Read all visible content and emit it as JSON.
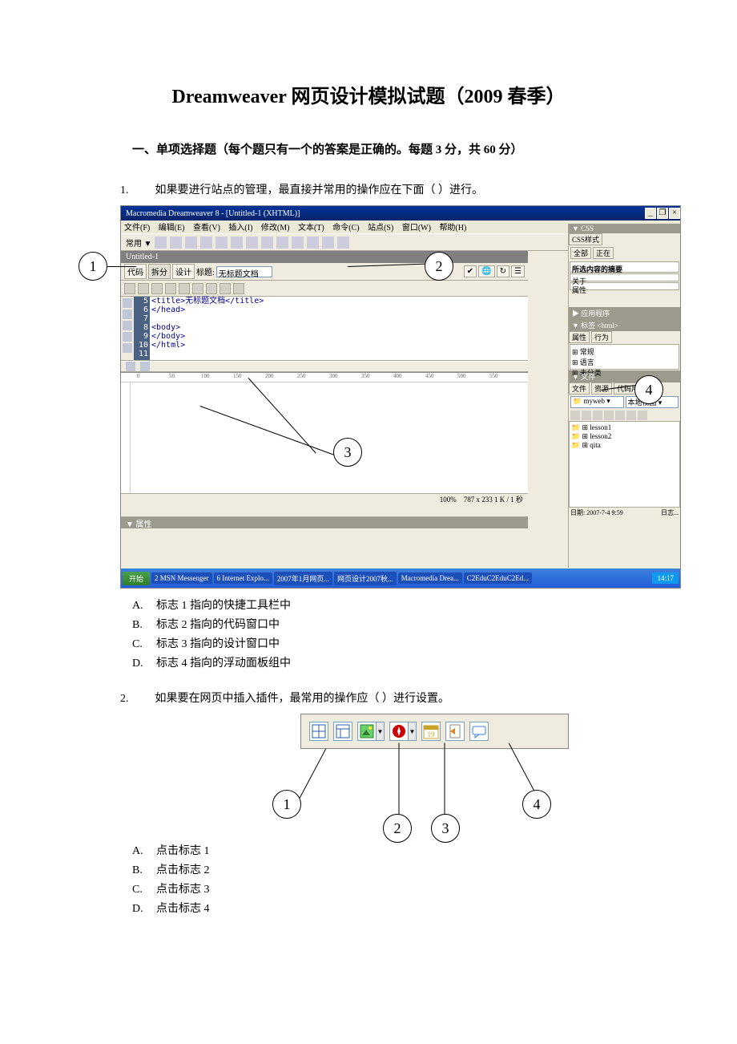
{
  "title": "Dreamweaver 网页设计模拟试题（2009 春季）",
  "section1": "一、单项选择题（每个题只有一个的答案是正确的。每题 3 分，共 60 分）",
  "q1": {
    "num": "1.",
    "stem": "如果要进行站点的管理，最直接并常用的操作应在下面（        ）进行。",
    "optA_letter": "A.",
    "optA": "标志 1 指向的快捷工具栏中",
    "optB_letter": "B.",
    "optB": "标志 2 指向的代码窗口中",
    "optC_letter": "C.",
    "optC": "标志 3 指向的设计窗口中",
    "optD_letter": "D.",
    "optD": "标志 4 指向的浮动面板组中"
  },
  "q2": {
    "num": "2.",
    "stem": "如果要在网页中插入插件，最常用的操作应（        ）进行设置。",
    "optA_letter": "A.",
    "optA": "点击标志 1",
    "optB_letter": "B.",
    "optB": "点击标志 2",
    "optC_letter": "C.",
    "optC": "点击标志 3",
    "optD_letter": "D.",
    "optD": "点击标志 4"
  },
  "screenshot1": {
    "window_title": "Macromedia Dreamweaver 8 - [Untitled-1 (XHTML)]",
    "menu_file": "文件(F)",
    "menu_edit": "编辑(E)",
    "menu_view": "查看(V)",
    "menu_insert": "插入(I)",
    "menu_modify": "修改(M)",
    "menu_text": "文本(T)",
    "menu_cmd": "命令(C)",
    "menu_site": "站点(S)",
    "menu_window": "窗口(W)",
    "menu_help": "帮助(H)",
    "insertbar_label": "常用 ▼",
    "tab_name": "Untitled-1",
    "view_code": "代码",
    "view_split": "拆分",
    "view_design": "设计",
    "title_label": "标题:",
    "title_value": "无标题文档",
    "code_line5": "<title>无标题文档</title>",
    "code_line6": "</head>",
    "code_line8": "<body>",
    "code_line9": "</body>",
    "code_line10": "</html>",
    "status_small": "787 x 233  1 K / 1 秒",
    "zoom": "100%",
    "prop_header": "▼ 属性",
    "panel_css": "▼ CSS",
    "panel_css_tab": "CSS样式",
    "css_sub1": "全部",
    "css_sub2": "正在",
    "css_heading": "所选内容的摘要",
    "css_about": "关于",
    "css_props": "属性",
    "panel_app": "▶ 应用程序",
    "panel_tag": "▼ 标签 <html>",
    "attr_tab": "属性",
    "behav_tab": "行为",
    "tree_general": "常规",
    "tree_lang": "语言",
    "tree_unc": "未分类",
    "panel_files": "▼ 文件",
    "files_tab1": "文件",
    "files_tab2": "资源",
    "files_tab3": "代码片断",
    "site_name": "myweb",
    "view_label": "本地视图",
    "folder1": "lesson1",
    "folder2": "lesson2",
    "folder3": "qita",
    "date_label": "日期: 2007-7-4 9:59",
    "log_label": "日志...",
    "tb_start": "开始",
    "tb_item1": "2 MSN Messenger",
    "tb_item2": "6 Internet Explo...",
    "tb_item3": "2007年1月网页...",
    "tb_item4": "网页设计2007秋...",
    "tb_item5": "Macromedia Drea...",
    "tb_item6": "C2EduC2EduC2Ed...",
    "tb_time": "14:17",
    "callout1": "1",
    "callout2": "2",
    "callout3": "3",
    "callout4": "4"
  },
  "screenshot2": {
    "icon_table": "table-icon",
    "icon_layout": "layout-icon",
    "icon_image": "image-icon",
    "icon_media": "media-icon",
    "icon_date": "date-icon",
    "icon_inc": "include-icon",
    "icon_comment": "comment-icon",
    "date_num": "19",
    "callout1": "1",
    "callout2": "2",
    "callout3": "3",
    "callout4": "4"
  }
}
